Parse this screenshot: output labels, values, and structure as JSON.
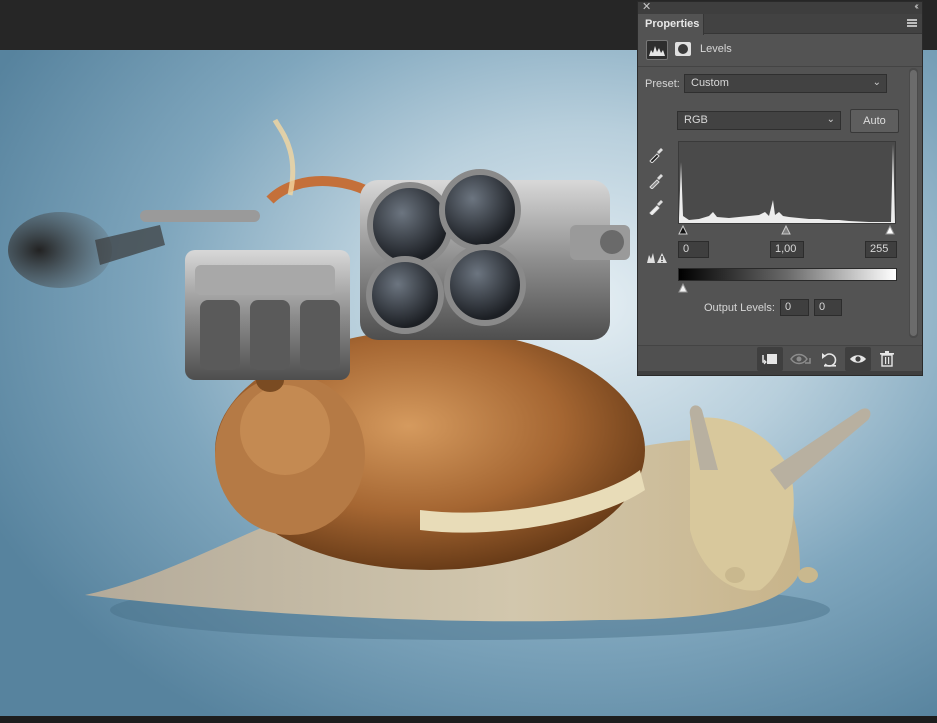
{
  "panel": {
    "tab_label": "Properties",
    "adjustment_title": "Levels",
    "preset_label": "Preset:",
    "preset_value": "Custom",
    "channel_value": "RGB",
    "auto_label": "Auto",
    "input_black": "0",
    "input_gamma": "1,00",
    "input_white": "255",
    "output_label": "Output Levels:",
    "output_black": "0",
    "output_white": "0"
  },
  "icons": {
    "close": "close-icon",
    "collapse": "collapse-panel-icon",
    "menu": "panel-menu-icon",
    "levels": "levels-histogram-icon",
    "mask": "layer-mask-icon",
    "black_point": "eyedropper-black-icon",
    "gray_point": "eyedropper-gray-icon",
    "white_point": "eyedropper-white-icon",
    "clipping_warning": "clipping-warning-icon",
    "clip_to_layer": "clip-to-layer-icon",
    "view_previous": "view-previous-state-icon",
    "reset": "reset-icon",
    "visibility": "visibility-eye-icon",
    "delete": "trash-icon"
  },
  "colors": {
    "panel_bg": "#535353",
    "canvas_bg_center": "#e6eff4",
    "canvas_bg_edge": "#57839e"
  }
}
